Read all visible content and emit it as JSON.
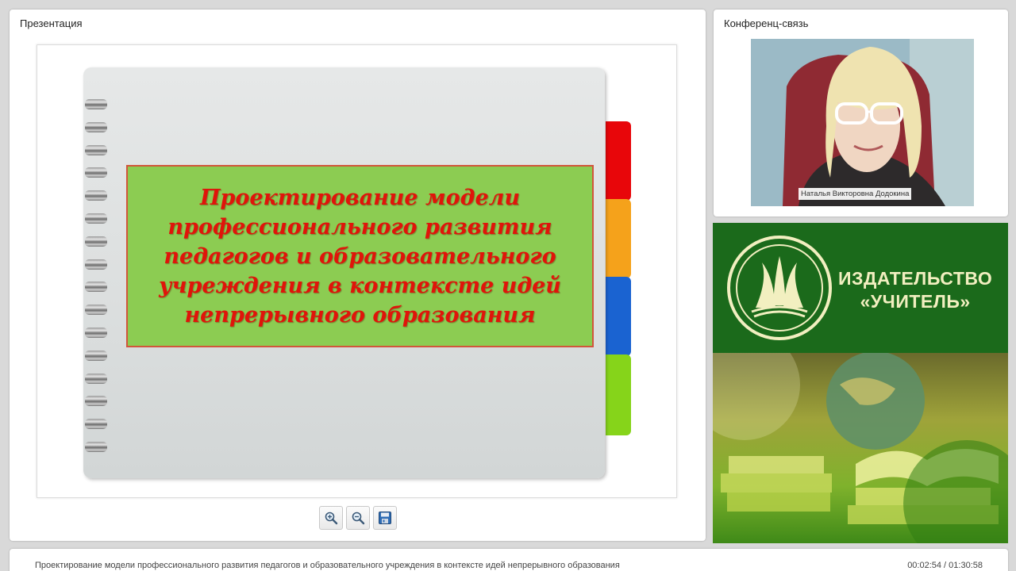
{
  "presentation": {
    "panel_title": "Презентация",
    "slide_title": "Проектирование модели профессионального развития педагогов и образовательного учреждения в контексте идей непрерывного образования",
    "tab_colors": [
      "#e8060a",
      "#f5a21b",
      "#1a63d1",
      "#86d41a"
    ],
    "tools": [
      {
        "name": "zoom-in-button",
        "icon": "zoom-in-icon"
      },
      {
        "name": "zoom-out-button",
        "icon": "zoom-out-icon"
      },
      {
        "name": "save-button",
        "icon": "save-icon"
      }
    ]
  },
  "conference": {
    "panel_title": "Конференц-связь",
    "participant_name": "Наталья Викторовна Додокина"
  },
  "brand": {
    "name_line1": "ИЗДАТЕЛЬСТВО",
    "name_line2": "«УЧИТЕЛЬ»",
    "background_color": "#1b6a1b"
  },
  "footer": {
    "title": "Проектирование модели профессионального развития педагогов и образовательного учреждения в контексте идей непрерывного образования",
    "time": "00:02:54 / 01:30:58"
  }
}
